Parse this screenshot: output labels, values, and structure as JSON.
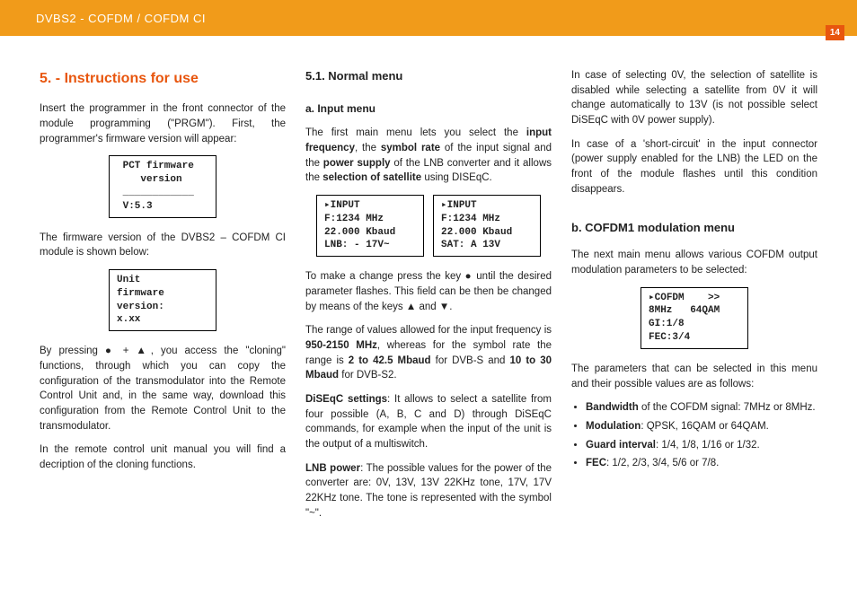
{
  "header": {
    "title": "DVBS2 - COFDM / COFDM CI",
    "page_number": "14"
  },
  "col1": {
    "section_heading": "5. - Instructions for use",
    "p1": "Insert the programmer in the front connector of the module programming (\"PRGM\"). First, the programmer's firmware version will appear:",
    "lcd1": " PCT firmware\n    version\n ____________\n V:5.3",
    "p2": "The firmware version of the DVBS2 – COFDM CI module is shown below:",
    "lcd2": "Unit\nfirmware\nversion:\nx.xx",
    "p3_a": "By pressing ● + ▲, you access the \"cloning\" functions, through which you can copy the configuration of the transmodulator into the Remote Control Unit and, in the same way, download this configuration from the Remote Control Unit to the transmodulator.",
    "p3_b": "In the remote control unit manual you will find a decription of the cloning functions."
  },
  "col2": {
    "h_sub": "5.1. Normal menu",
    "h_sub2": "a. Input menu",
    "p1_a": "The first main menu lets you select the ",
    "p1_b": "input frequency",
    "p1_c": ", the ",
    "p1_d": "symbol rate",
    "p1_e": " of the input signal and the ",
    "p1_f": "power supply",
    "p1_g": " of the LNB converter and it allows the ",
    "p1_h": "selection of satellite",
    "p1_i": " using DISEqC.",
    "lcdL": "▸INPUT\nF:1234 MHz\n22.000 Kbaud\nLNB: - 17V~",
    "lcdR": "▸INPUT\nF:1234 MHz\n22.000 Kbaud\nSAT: A 13V",
    "p2": "To make a change press the key ● until the desired parameter flashes. This field can be then be changed by means of the keys ▲ and ▼.",
    "p3_a": "The range of values allowed for the input frequency is ",
    "p3_b": "950-2150 MHz",
    "p3_c": ", whereas for the symbol rate the range is ",
    "p3_d": "2 to 42.5 Mbaud",
    "p3_e": " for DVB-S and ",
    "p3_f": "10 to 30 Mbaud",
    "p3_g": " for DVB-S2.",
    "p4_a": "DiSEqC settings",
    "p4_b": ": It allows to select a satellite from  four possible (A, B, C and D) through DiSEqC commands, for example when the input of the unit is the output of a multiswitch.",
    "p5_a": "LNB power",
    "p5_b": ": The possible values for the power of the converter are: 0V, 13V, 13V 22KHz tone, 17V, 17V 22KHz tone. The tone is represented with the symbol \"~\"."
  },
  "col3": {
    "p1": "In  case of selecting 0V, the selection of satellite is disabled while selecting a satellite from 0V it will change automatically  to 13V (is not possible select DiSEqC with 0V power supply).",
    "p2": "In case of a 'short-circuit' in the input connector (power supply enabled for the LNB) the LED on the front of the module flashes until this condition disappears.",
    "h_sub": "b. COFDM1 modulation menu",
    "p3": "The next main menu allows various COFDM output modulation parameters to be selected:",
    "lcd": "▸COFDM    >>\n8MHz   64QAM\nGI:1/8\nFEC:3/4",
    "p4": "The parameters that can be selected in this menu and their possible values are as follows:",
    "li1_a": "Bandwidth",
    "li1_b": " of the COFDM signal: 7MHz or 8MHz.",
    "li2_a": "Modulation",
    "li2_b": ": QPSK, 16QAM or 64QAM.",
    "li3_a": "Guard interval",
    "li3_b": ": 1/4, 1/8, 1/16 or 1/32.",
    "li4_a": "FEC",
    "li4_b": ": 1/2, 2/3, 3/4, 5/6 or 7/8."
  }
}
